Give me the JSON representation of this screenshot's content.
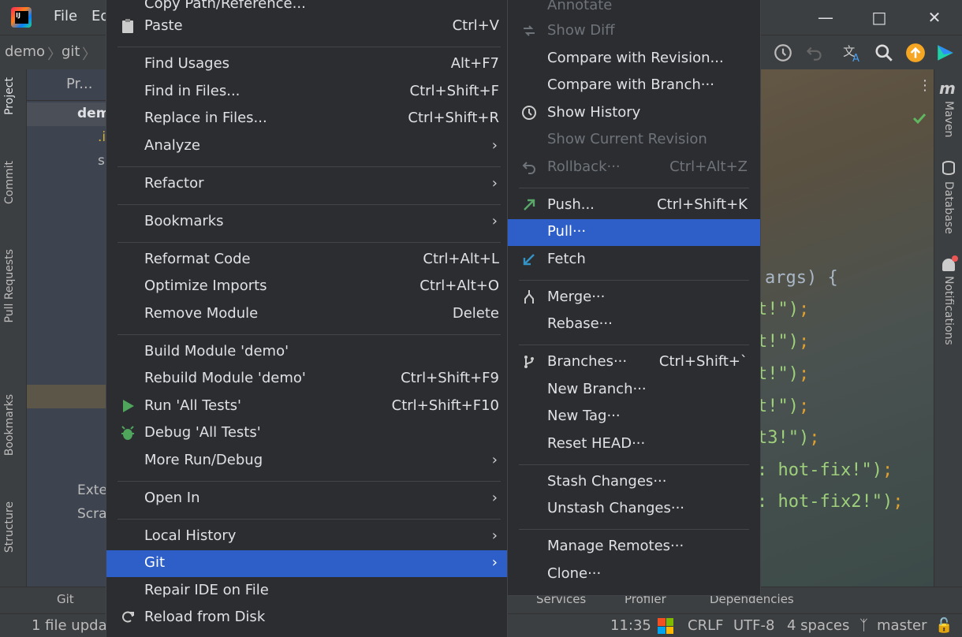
{
  "titlebar": {
    "menu_file": "File",
    "menu_edit": "Ed"
  },
  "navbar": {
    "crumb1": "demo",
    "crumb2": "git"
  },
  "left_tabs": {
    "project": "Project",
    "commit": "Commit",
    "pull_requests": "Pull Requests",
    "bookmarks": "Bookmarks",
    "structure": "Structure"
  },
  "right_tabs": {
    "maven": "Maven",
    "database": "Database",
    "notifications": "Notifications"
  },
  "project_panel": {
    "header": "Pr...",
    "rows": [
      "dem",
      ".i",
      "s",
      "",
      "",
      "",
      "",
      "",
      "",
      "·",
      "Exte",
      "Scra"
    ]
  },
  "editor": {
    "lines": [
      {
        "code": "args) {",
        "str": "",
        "semi": ""
      },
      {
        "code": "",
        "str": "t!\")",
        "semi": ";"
      },
      {
        "code": "",
        "str": "t!\")",
        "semi": ";"
      },
      {
        "code": "",
        "str": "t!\")",
        "semi": ";"
      },
      {
        "code": "",
        "str": "t!\")",
        "semi": ";"
      },
      {
        "code": "",
        "str": "t3!\")",
        "semi": ";"
      },
      {
        "code": "",
        "str": ": hot-fix!\")",
        "semi": ";"
      },
      {
        "code": "",
        "str": ": hot-fix2!\")",
        "semi": ";"
      }
    ]
  },
  "bottom_tools": {
    "git": "Git",
    "services": "Services",
    "profiler": "Profiler",
    "dependencies": "Dependencies"
  },
  "status": {
    "message": "1 file updat",
    "time": "11:35",
    "line_sep": "CRLF",
    "encoding": "UTF-8",
    "indent": "4 spaces",
    "branch": "master"
  },
  "context_menu": {
    "top_partial": "Copy Path/Reference...",
    "items": [
      {
        "label": "Paste",
        "shortcut": "Ctrl+V",
        "icon": "clipboard-icon"
      },
      {
        "label": "Find Usages",
        "shortcut": "Alt+F7"
      },
      {
        "label": "Find in Files...",
        "shortcut": "Ctrl+Shift+F"
      },
      {
        "label": "Replace in Files...",
        "shortcut": "Ctrl+Shift+R"
      },
      {
        "label": "Analyze",
        "submenu": true
      },
      {
        "label": "Refactor",
        "submenu": true
      },
      {
        "label": "Bookmarks",
        "submenu": true
      },
      {
        "label": "Reformat Code",
        "shortcut": "Ctrl+Alt+L"
      },
      {
        "label": "Optimize Imports",
        "shortcut": "Ctrl+Alt+O"
      },
      {
        "label": "Remove Module",
        "shortcut": "Delete"
      },
      {
        "label": "Build Module 'demo'",
        "shortcut": ""
      },
      {
        "label": "Rebuild Module 'demo'",
        "shortcut": "Ctrl+Shift+F9"
      },
      {
        "label": "Run 'All Tests'",
        "shortcut": "Ctrl+Shift+F10",
        "icon": "run-icon"
      },
      {
        "label": "Debug 'All Tests'",
        "shortcut": "",
        "icon": "debug-icon"
      },
      {
        "label": "More Run/Debug",
        "submenu": true
      },
      {
        "label": "Open In",
        "submenu": true
      },
      {
        "label": "Local History",
        "submenu": true
      },
      {
        "label": "Git",
        "submenu": true,
        "selected": true
      },
      {
        "label": "Repair IDE on File",
        "shortcut": ""
      },
      {
        "label": "Reload from Disk",
        "shortcut": "",
        "icon": "reload-icon"
      }
    ]
  },
  "git_submenu": {
    "items": [
      {
        "label": "Annotate",
        "disabled": true
      },
      {
        "label": "Show Diff",
        "disabled": true,
        "icon": "diff-icon"
      },
      {
        "label": "Compare with Revision..."
      },
      {
        "label": "Compare with Branch···"
      },
      {
        "label": "Show History",
        "icon": "history-icon"
      },
      {
        "label": "Show Current Revision",
        "disabled": true
      },
      {
        "label": "Rollback···",
        "shortcut": "Ctrl+Alt+Z",
        "disabled": true,
        "icon": "rollback-icon"
      },
      {
        "label": "Push...",
        "shortcut": "Ctrl+Shift+K",
        "icon": "push-icon"
      },
      {
        "label": "Pull···",
        "selected": true
      },
      {
        "label": "Fetch",
        "icon": "fetch-icon"
      },
      {
        "label": "Merge···",
        "icon": "merge-icon"
      },
      {
        "label": "Rebase···"
      },
      {
        "label": "Branches···",
        "shortcut": "Ctrl+Shift+`",
        "icon": "branch-icon"
      },
      {
        "label": "New Branch···"
      },
      {
        "label": "New Tag···"
      },
      {
        "label": "Reset HEAD···"
      },
      {
        "label": "Stash Changes···"
      },
      {
        "label": "Unstash Changes···"
      },
      {
        "label": "Manage Remotes···"
      },
      {
        "label": "Clone···"
      }
    ]
  },
  "colors": {
    "selection": "#2e5fc9",
    "menu_bg": "#2b2d30",
    "run_green": "#4fa55c",
    "push_green": "#59a869",
    "fetch_blue": "#3592c4"
  }
}
